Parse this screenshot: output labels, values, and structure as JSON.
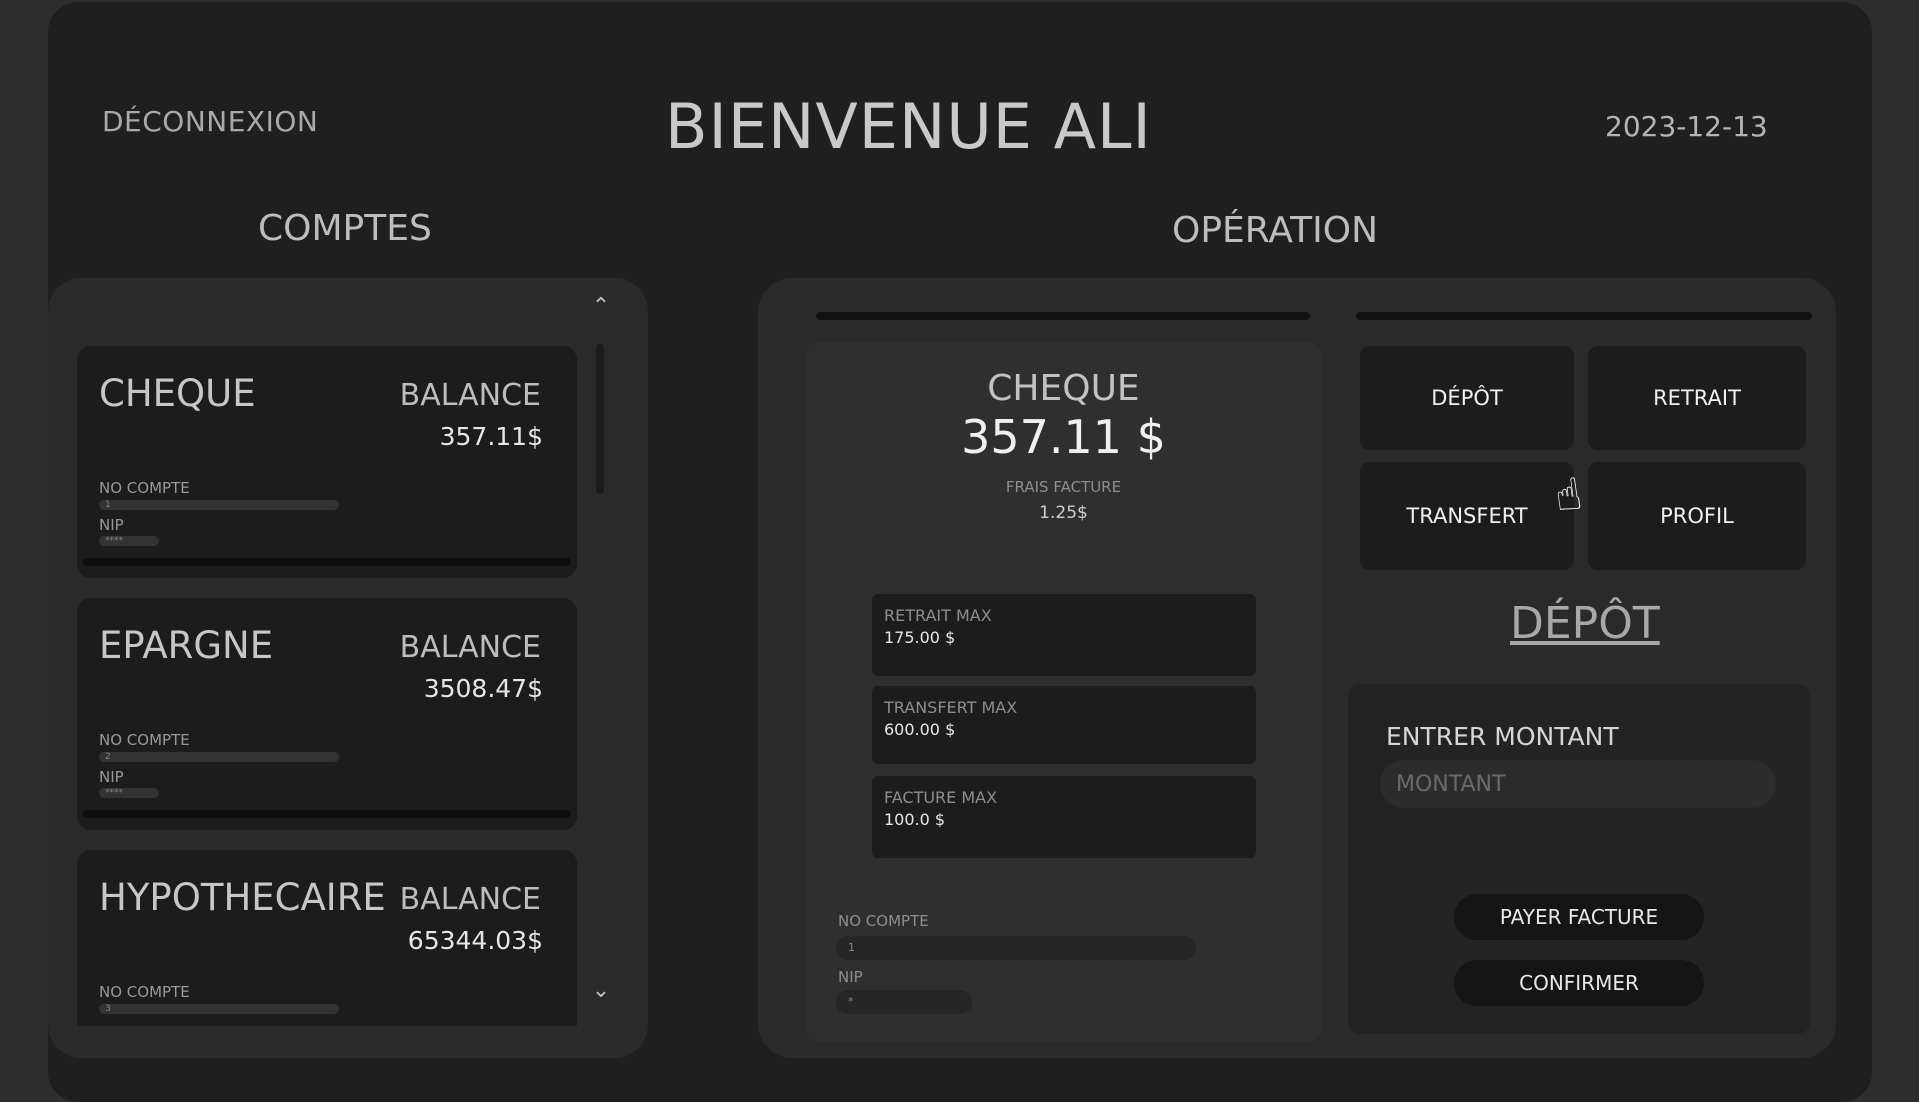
{
  "header": {
    "logout_label": "DÉCONNEXION",
    "welcome": "BIENVENUE ALI",
    "date": "2023-12-13"
  },
  "sections": {
    "accounts_title": "COMPTES",
    "operation_title": "OPÉRATION"
  },
  "accounts": [
    {
      "name": "CHEQUE",
      "balance_label": "BALANCE",
      "balance": "357.11$",
      "no_label": "NO COMPTE",
      "no_value": "1",
      "nip_label": "NIP",
      "nip_value": "****"
    },
    {
      "name": "EPARGNE",
      "balance_label": "BALANCE",
      "balance": "3508.47$",
      "no_label": "NO COMPTE",
      "no_value": "2",
      "nip_label": "NIP",
      "nip_value": "****"
    },
    {
      "name": "HYPOTHECAIRE",
      "balance_label": "BALANCE",
      "balance": "65344.03$",
      "no_label": "NO COMPTE",
      "no_value": "3"
    }
  ],
  "selected_account": {
    "name": "CHEQUE",
    "balance": "357.11 $",
    "fee_label": "FRAIS FACTURE",
    "fee": "1.25$",
    "limits": [
      {
        "label": "RETRAIT MAX",
        "value": "175.00 $"
      },
      {
        "label": "TRANSFERT MAX",
        "value": "600.00 $"
      },
      {
        "label": "FACTURE MAX",
        "value": "100.0 $"
      }
    ],
    "no_label": "NO COMPTE",
    "no_value": "1",
    "nip_label": "NIP",
    "nip_value": "*"
  },
  "operations": {
    "deposit": "DÉPÔT",
    "withdraw": "RETRAIT",
    "transfer": "TRANSFERT",
    "profile": "PROFIL"
  },
  "form": {
    "title": "DÉPÔT",
    "amount_label": "ENTRER MONTANT",
    "amount_placeholder": "MONTANT",
    "pay_bill": "PAYER FACTURE",
    "confirm": "CONFIRMER"
  },
  "icons": {
    "scroll_up": "chevron-up-icon",
    "scroll_down": "chevron-down-icon",
    "cursor": "hand-pointer-icon"
  }
}
